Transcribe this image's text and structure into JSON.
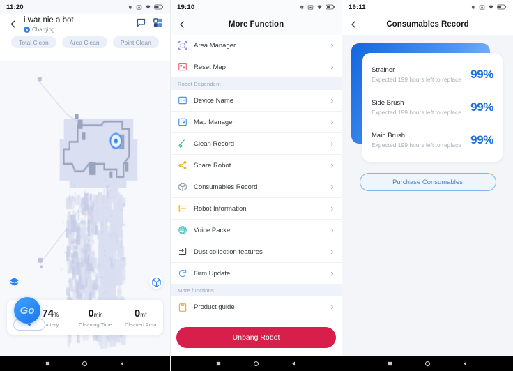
{
  "panel_map": {
    "status_bar": {
      "time": "11:20",
      "icons": [
        "settings-icon",
        "screenshot-icon",
        "wifi-icon",
        "battery-icon"
      ]
    },
    "back_icon": "back-chevron-icon",
    "robot_name": "i war nie a bot",
    "status_text": "Charging",
    "status_icon": "charging-bolt-icon",
    "header_icons": [
      "message-bubble-icon",
      "dashboard-grid-icon"
    ],
    "chips": [
      {
        "label": "Total Clean"
      },
      {
        "label": "Area Clean"
      },
      {
        "label": "Point Clean"
      }
    ],
    "map_buttons": {
      "layers_icon": "map-layers-icon",
      "cube_icon": "3d-cube-icon"
    },
    "go_label": "Go",
    "battery_icon": "battery-charging-icon",
    "stats": [
      {
        "value": "74",
        "unit": "%",
        "label": "Battery"
      },
      {
        "value": "0",
        "unit": "min",
        "label": "Cleaning Time"
      },
      {
        "value": "0",
        "unit": "m²",
        "label": "Cleaned Area"
      }
    ]
  },
  "panel_menu": {
    "status_bar": {
      "time": "19:10"
    },
    "title": "More Function",
    "groups": [
      {
        "header": "",
        "items": [
          {
            "label": "Area Manager",
            "icon": "area-manager-icon",
            "color": "#5b5fd6"
          },
          {
            "label": "Reset Map",
            "icon": "reset-map-icon",
            "color": "#e8566f"
          }
        ]
      },
      {
        "header": "Robot Dependent",
        "items": [
          {
            "label": "Device Name",
            "icon": "device-name-icon",
            "color": "#3c86e8"
          },
          {
            "label": "Map Manager",
            "icon": "map-manager-icon",
            "color": "#3c86e8"
          },
          {
            "label": "Clean Record",
            "icon": "clean-record-icon",
            "color": "#35b88a"
          },
          {
            "label": "Share Robot",
            "icon": "share-robot-icon",
            "color": "#f0b428"
          },
          {
            "label": "Consumables Record",
            "icon": "consumables-icon",
            "color": "#8a95a4"
          },
          {
            "label": "Robot Information",
            "icon": "robot-info-icon",
            "color": "#f0c33c"
          },
          {
            "label": "Voice Packet",
            "icon": "voice-packet-icon",
            "color": "#3bc3c0"
          },
          {
            "label": "Dust collection features",
            "icon": "dust-collection-icon",
            "color": "#3a4048"
          },
          {
            "label": "Firm Update",
            "icon": "firm-update-icon",
            "color": "#5ba3ea"
          }
        ]
      },
      {
        "header": "More functions",
        "items": [
          {
            "label": "Product guide",
            "icon": "product-guide-icon",
            "color": "#e0a335"
          }
        ]
      }
    ],
    "unbang_label": "Unbang Robot",
    "unbang_color": "#d81e4a"
  },
  "panel_consumables": {
    "status_bar": {
      "time": "19:11"
    },
    "title": "Consumables Record",
    "items": [
      {
        "name": "Strainer",
        "subtitle": "Expected 199 hours left to replace",
        "percent": "99%"
      },
      {
        "name": "Side Brush",
        "subtitle": "Expected 199 hours left to replace",
        "percent": "99%"
      },
      {
        "name": "Main Brush",
        "subtitle": "Expected 199 hours left to replace",
        "percent": "99%"
      }
    ],
    "purchase_label": "Purchase Consumables"
  },
  "android_nav": {
    "recent": "recent-apps-icon",
    "home": "home-icon",
    "back": "back-triangle-icon"
  }
}
